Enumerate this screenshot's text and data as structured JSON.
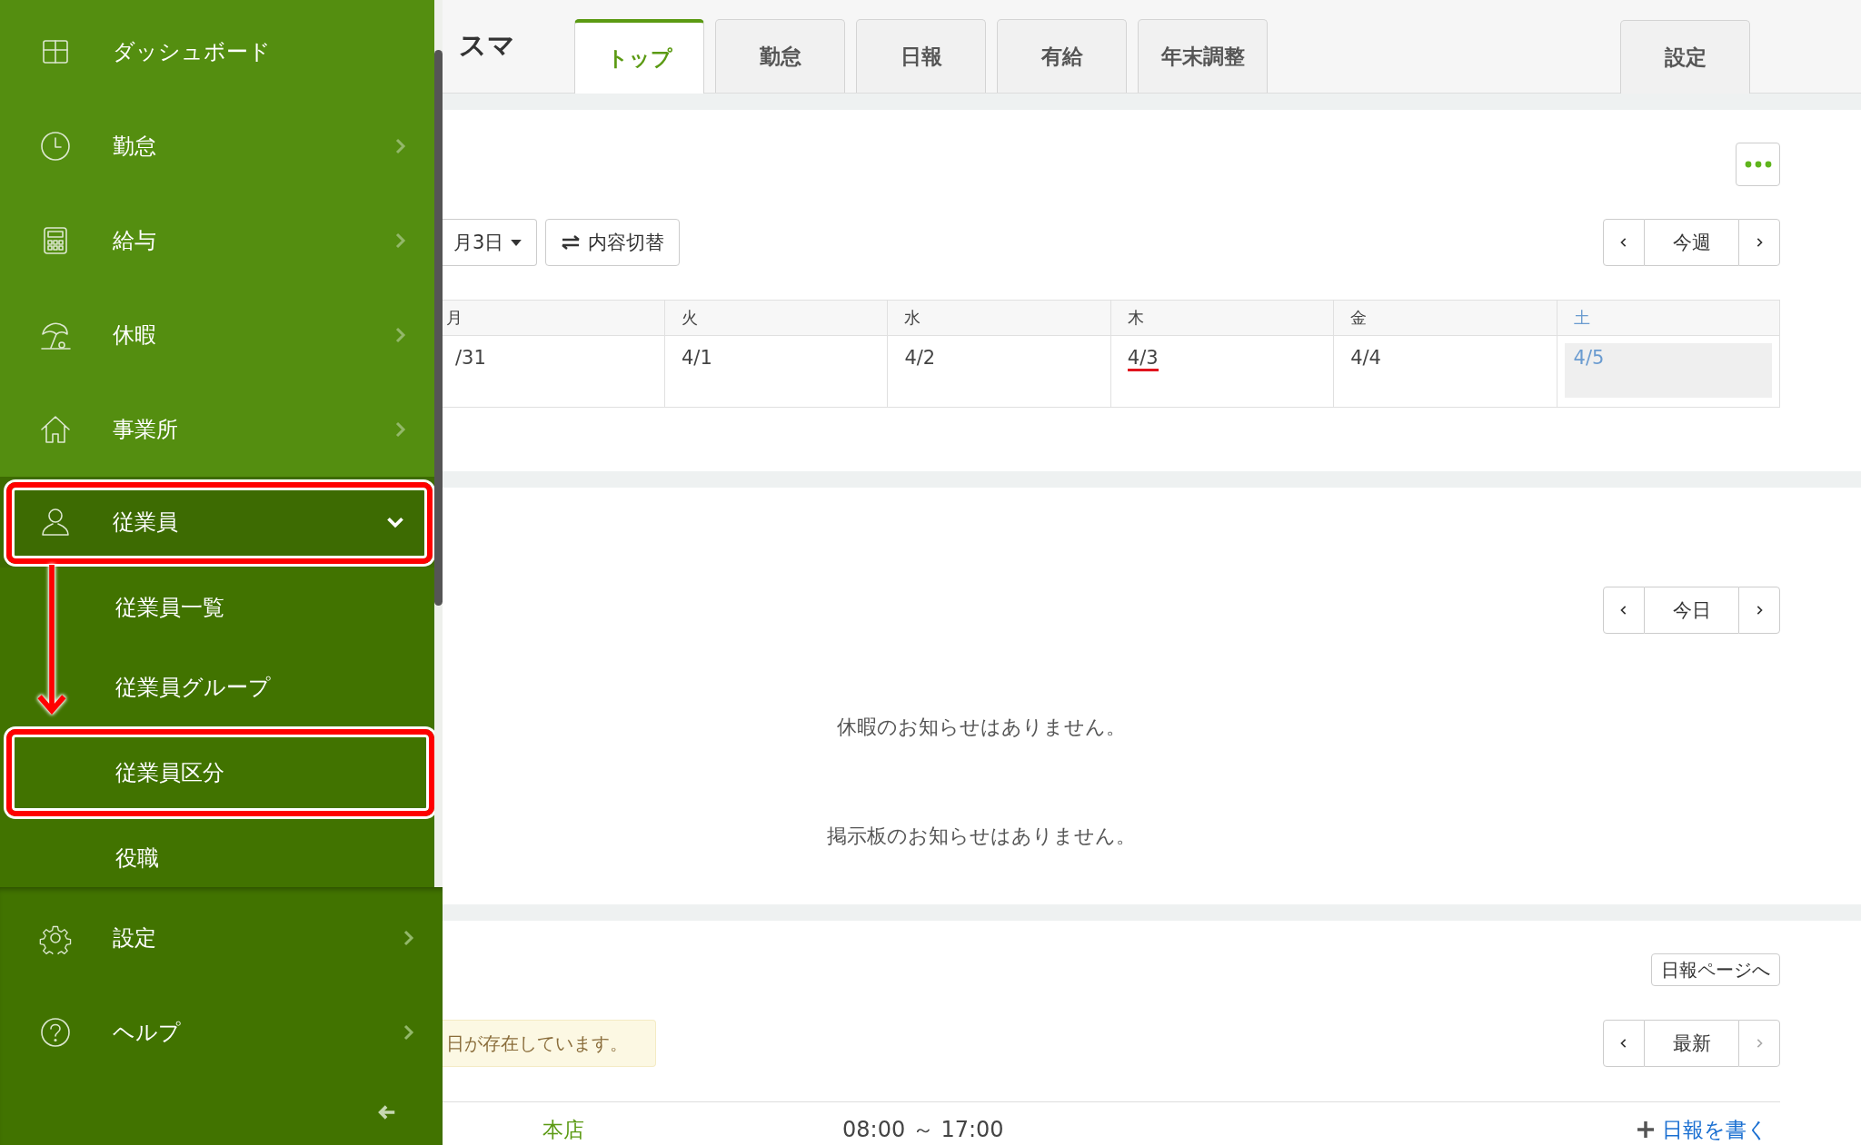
{
  "sidebar": {
    "items": [
      {
        "label": "ダッシュボード",
        "kind": "dashboard",
        "has_submenu": false,
        "expanded": false,
        "highlighted": false
      },
      {
        "label": "勤怠",
        "kind": "clock",
        "has_submenu": true,
        "expanded": false,
        "highlighted": false
      },
      {
        "label": "給与",
        "kind": "calculator",
        "has_submenu": true,
        "expanded": false,
        "highlighted": false
      },
      {
        "label": "休暇",
        "kind": "umbrella",
        "has_submenu": true,
        "expanded": false,
        "highlighted": false
      },
      {
        "label": "事業所",
        "kind": "house",
        "has_submenu": true,
        "expanded": false,
        "highlighted": false
      },
      {
        "label": "従業員",
        "kind": "person",
        "has_submenu": true,
        "expanded": true,
        "highlighted": true,
        "children": [
          {
            "label": "従業員一覧",
            "highlighted": false
          },
          {
            "label": "従業員グループ",
            "highlighted": false
          },
          {
            "label": "従業員区分",
            "highlighted": true
          },
          {
            "label": "役職",
            "highlighted": false
          }
        ]
      }
    ],
    "bottom_items": [
      {
        "label": "設定",
        "kind": "gear",
        "has_submenu": true
      },
      {
        "label": "ヘルプ",
        "kind": "question",
        "has_submenu": true
      }
    ]
  },
  "header": {
    "app_name": "スマ",
    "tabs": [
      {
        "label": "トップ",
        "selected": true
      },
      {
        "label": "勤怠",
        "selected": false
      },
      {
        "label": "日報",
        "selected": false
      },
      {
        "label": "有給",
        "selected": false
      },
      {
        "label": "年末調整",
        "selected": false
      }
    ],
    "right_tabs": [
      {
        "label": "設定",
        "selected": false
      }
    ]
  },
  "week_calendar": {
    "date_picker": "月3日",
    "toggle_button": "内容切替",
    "nav_label": "今週",
    "days": [
      {
        "day": "月",
        "date": "/31",
        "today": false,
        "kind": "weekday"
      },
      {
        "day": "火",
        "date": "4/1",
        "today": false,
        "kind": "weekday"
      },
      {
        "day": "水",
        "date": "4/2",
        "today": false,
        "kind": "weekday"
      },
      {
        "day": "木",
        "date": "4/3",
        "today": true,
        "kind": "weekday"
      },
      {
        "day": "金",
        "date": "4/4",
        "today": false,
        "kind": "weekday"
      },
      {
        "day": "土",
        "date": "4/5",
        "today": false,
        "kind": "saturday"
      }
    ]
  },
  "notices": {
    "nav_label": "今日",
    "messages": [
      "休暇のお知らせはありません。",
      "掲示板のお知らせはありません。"
    ]
  },
  "daily_report": {
    "page_button": "日報ページへ",
    "alert": "日が存在しています。",
    "nav_label": "最新",
    "next_disabled": true,
    "rows": [
      {
        "office": "本店",
        "hours": "08:00 ～ 17:00",
        "action": "日報を書く"
      }
    ]
  }
}
